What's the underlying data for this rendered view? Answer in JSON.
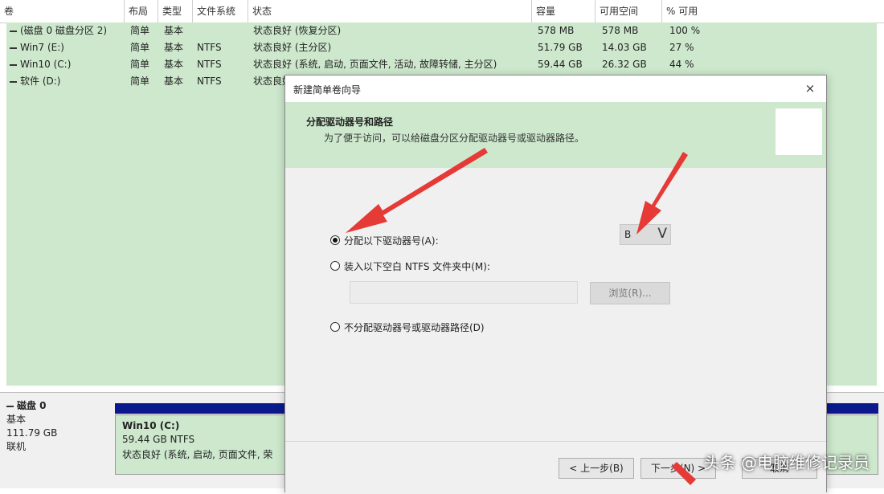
{
  "columns": [
    "卷",
    "布局",
    "类型",
    "文件系统",
    "状态",
    "容量",
    "可用空间",
    "% 可用"
  ],
  "volumes": [
    {
      "name": "(磁盘 0 磁盘分区 2)",
      "layout": "简单",
      "type": "基本",
      "fs": "",
      "status": "状态良好 (恢复分区)",
      "capacity": "578 MB",
      "free": "578 MB",
      "pct": "100 %"
    },
    {
      "name": "Win7 (E:)",
      "layout": "简单",
      "type": "基本",
      "fs": "NTFS",
      "status": "状态良好 (主分区)",
      "capacity": "51.79 GB",
      "free": "14.03 GB",
      "pct": "27 %"
    },
    {
      "name": "Win10 (C:)",
      "layout": "简单",
      "type": "基本",
      "fs": "NTFS",
      "status": "状态良好 (系统, 启动, 页面文件, 活动, 故障转储, 主分区)",
      "capacity": "59.44 GB",
      "free": "26.32 GB",
      "pct": "44 %"
    },
    {
      "name": "软件 (D:)",
      "layout": "简单",
      "type": "基本",
      "fs": "NTFS",
      "status": "状态良好",
      "capacity": "",
      "free": "",
      "pct": ""
    }
  ],
  "disk": {
    "name": "磁盘 0",
    "type": "基本",
    "size": "111.79 GB",
    "state": "联机"
  },
  "partition": {
    "name": "Win10  (C:)",
    "size": "59.44 GB NTFS",
    "status": "状态良好 (系统, 启动, 页面文件, 荣"
  },
  "dialog": {
    "title": "新建简单卷向导",
    "close": "×",
    "header_title": "分配驱动器号和路径",
    "header_desc": "为了便于访问，可以给磁盘分区分配驱动器号或驱动器路径。",
    "option_assign": "分配以下驱动器号(A):",
    "option_mount": "装入以下空白 NTFS 文件夹中(M):",
    "option_none": "不分配驱动器号或驱动器路径(D)",
    "drive_letter": "B",
    "drive_chevron": "V",
    "browse": "浏览(R)...",
    "back": "< 上一步(B)",
    "next": "下一步(N) >",
    "cancel": "取消"
  },
  "watermark": "头条 @电脑维修记录员",
  "colors": {
    "panel_green": "#cde8cd",
    "disk_bar": "#0a1a8c",
    "arrow": "#e53a36"
  }
}
